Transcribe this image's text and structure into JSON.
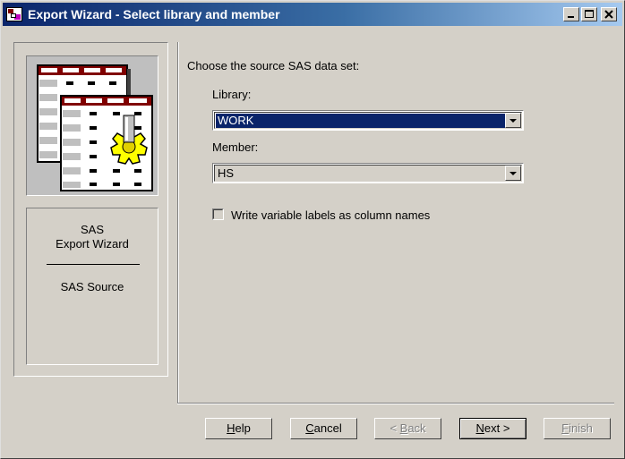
{
  "window": {
    "title": "Export Wizard - Select library and member"
  },
  "title_buttons": {
    "minimize": "minimize-icon",
    "maximize": "maximize-icon",
    "close": "close-icon"
  },
  "sidebar": {
    "line1": "SAS",
    "line2": "Export Wizard",
    "step": "SAS Source"
  },
  "main": {
    "prompt": "Choose the source SAS data set:",
    "library": {
      "label": "Library:",
      "value": "WORK"
    },
    "member": {
      "label": "Member:",
      "value": "HS"
    },
    "checkbox": {
      "label": "Write variable labels as column names",
      "checked": false
    }
  },
  "buttons": {
    "help": {
      "pre": "",
      "mn": "H",
      "post": "elp"
    },
    "cancel": {
      "pre": "",
      "mn": "C",
      "post": "ancel"
    },
    "back": {
      "pre": "< ",
      "mn": "B",
      "post": "ack"
    },
    "next": {
      "pre": "",
      "mn": "N",
      "post": "ext >"
    },
    "finish": {
      "pre": "",
      "mn": "F",
      "post": "inish"
    }
  },
  "colors": {
    "titlebar_start": "#0a246a",
    "titlebar_end": "#a6caf0",
    "selection": "#0a246a",
    "face": "#d4d0c8"
  }
}
